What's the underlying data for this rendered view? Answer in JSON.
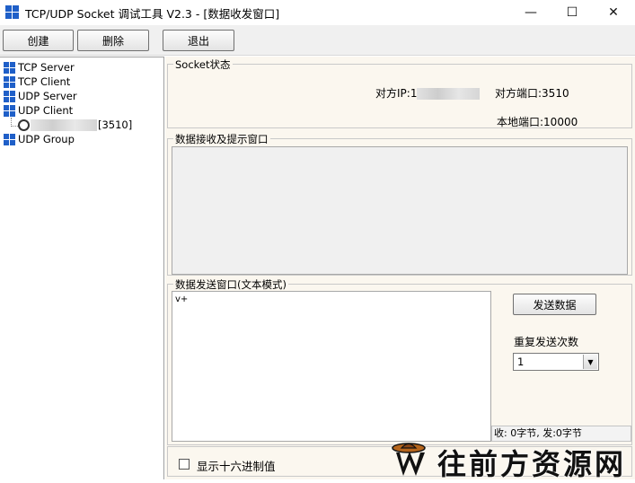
{
  "window": {
    "title": "TCP/UDP Socket 调试工具 V2.3 - [数据收发窗口]",
    "min_glyph": "—",
    "max_glyph": "☐",
    "close_glyph": "✕"
  },
  "toolbar": {
    "create_label": "创建",
    "delete_label": "删除",
    "exit_label": "退出"
  },
  "tree": {
    "tcp_server": "TCP Server",
    "tcp_client": "TCP Client",
    "udp_server": "UDP Server",
    "udp_client": "UDP Client",
    "client_port": "[3510]",
    "udp_group": "UDP Group"
  },
  "socket_status": {
    "title": "Socket状态",
    "peer_ip_label": "对方IP:1",
    "peer_port_label": "对方端口:3510",
    "local_port_label": "本地端口:10000"
  },
  "receive": {
    "title": "数据接收及提示窗口"
  },
  "send": {
    "title": "数据发送窗口(文本模式)",
    "text": "v+",
    "send_button": "发送数据",
    "repeat_label": "重复发送次数",
    "repeat_value": "1",
    "stats": "收: 0字节, 发:0字节"
  },
  "options": {
    "hex_label": "显示十六进制值"
  },
  "watermark": {
    "text": "往前方资源网"
  },
  "colors": {
    "tree_blue": "#1f5fc8",
    "panel_bg": "#fbf7ef"
  }
}
